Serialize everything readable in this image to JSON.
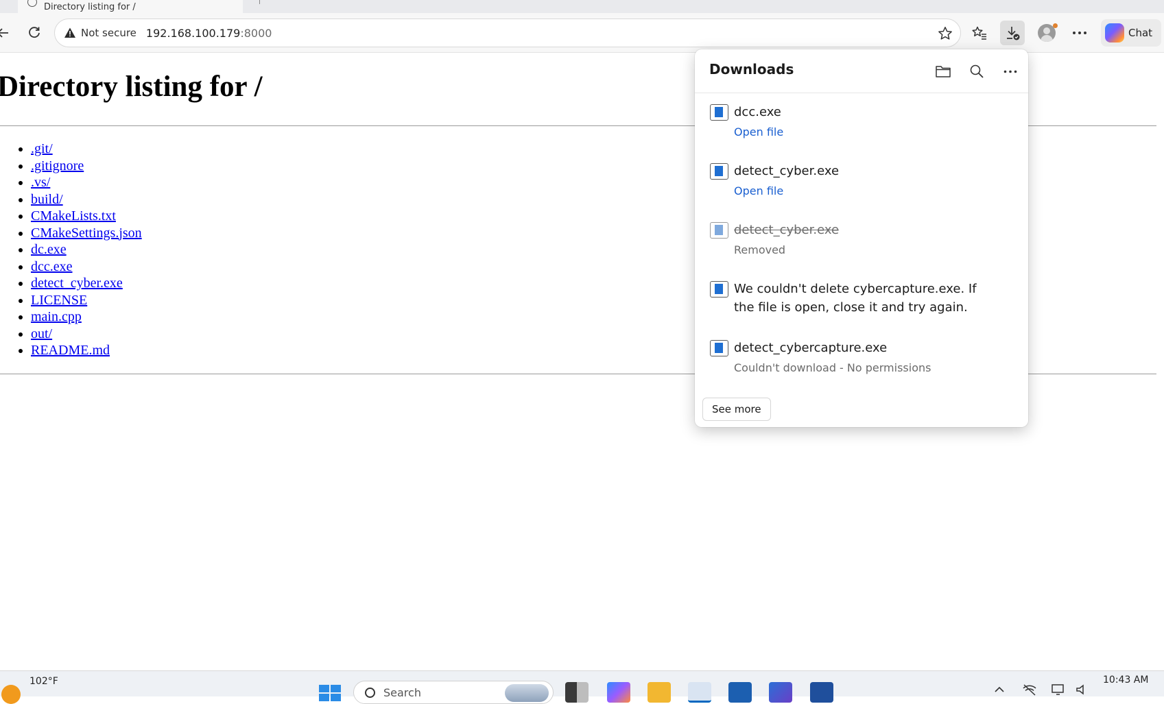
{
  "tab": {
    "title": "Directory listing for /"
  },
  "address": {
    "security_label": "Not secure",
    "host": "192.168.100.179",
    "port": ":8000"
  },
  "toolbar": {
    "chat_label": "Chat"
  },
  "page": {
    "heading": "Directory listing for /",
    "files": [
      ".git/",
      ".gitignore",
      ".vs/",
      "build/",
      "CMakeLists.txt",
      "CMakeSettings.json",
      "dc.exe",
      "dcc.exe",
      "detect_cyber.exe",
      "LICENSE",
      "main.cpp",
      "out/",
      "README.md"
    ]
  },
  "downloads": {
    "title": "Downloads",
    "items": [
      {
        "name": "dcc.exe",
        "action": "Open file"
      },
      {
        "name": "detect_cyber.exe",
        "action": "Open file"
      },
      {
        "name": "detect_cyber.exe",
        "status": "Removed"
      },
      {
        "message": "We couldn't delete cybercapture.exe. If the file is open, close it and try again."
      },
      {
        "name": "detect_cybercapture.exe",
        "status": "Couldn't download - No permissions"
      }
    ],
    "see_more": "See more"
  },
  "taskbar": {
    "weather_temp": "102°F",
    "search_placeholder": "Search",
    "clock_time": "10:43 AM"
  },
  "icons": {
    "accent": "#1f6fd2",
    "link": "#0000ee"
  }
}
